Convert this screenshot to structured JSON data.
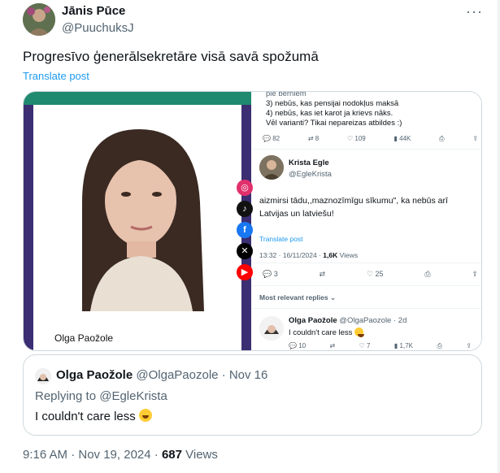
{
  "post": {
    "author_name": "Jānis Pūce",
    "author_handle": "@PuuchuksJ",
    "text": "Progresīvo ģenerālsekretāre visā savā spožumā",
    "translate_label": "Translate post",
    "more_icon": "more-horizontal-icon",
    "footer_time": "9:16 AM · Nov 19, 2024 · ",
    "footer_views": "687",
    "footer_views_label": " Views"
  },
  "media": {
    "caption": "Olga Paožole",
    "social_icons": [
      "instagram-icon",
      "tiktok-icon",
      "facebook-icon",
      "x-icon",
      "youtube-icon"
    ],
    "screenshot": {
      "lines_top": [
        "pie bērniem",
        "3) nebūs, kas pensijai nodokļus maksā",
        "4) nebūs, kas iet karot ja krievs nāks.",
        "Vēl varianti? Tikai nepareizas atbildes :)"
      ],
      "stats_top": [
        "82",
        "8",
        "109",
        "44K"
      ],
      "reply_author": "Krista Egle",
      "reply_handle": "@EgleKrista",
      "reply_text_1": "aizmirsi tādu,,maznozīmīgu sīkumu\", ka nebūs arī",
      "reply_text_2": "Latvijas un latviešu!",
      "reply_translate": "Translate post",
      "reply_time": "13:32 · 16/11/2024 · ",
      "reply_views": "1,6K",
      "reply_views_label": " Views",
      "stats_mid": [
        "3",
        "25"
      ],
      "relevant": "Most relevant replies",
      "nested_author": "Olga Paožole",
      "nested_handle": "@OlgaPaozole · 2d",
      "nested_text": "I couldn't care less",
      "stats_bottom": [
        "10",
        "7",
        "1,7K"
      ]
    }
  },
  "quote": {
    "name": "Olga Paožole",
    "handle_time": "@OlgaPaozole · Nov 16",
    "replying_label": "Replying to ",
    "replying_handle": "@EgleKrista",
    "text": "I couldn't care less"
  }
}
